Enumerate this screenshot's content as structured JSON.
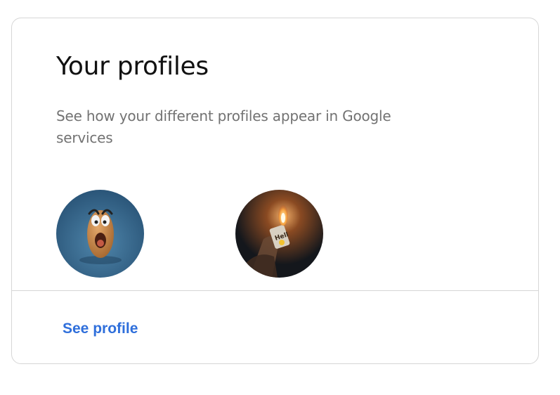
{
  "card": {
    "title": "Your profiles",
    "subtitle": "See how your different profiles appear in Google services",
    "avatars": [
      {
        "icon": "cartoon-egg-face-avatar",
        "background": "#2f5f86"
      },
      {
        "icon": "lighter-flame-photo-avatar",
        "background": "#14171c"
      }
    ],
    "action_label": "See profile"
  },
  "colors": {
    "link": "#2f6fdb",
    "title": "#111111",
    "subtitle": "#727272",
    "border": "#d6d6d6"
  }
}
